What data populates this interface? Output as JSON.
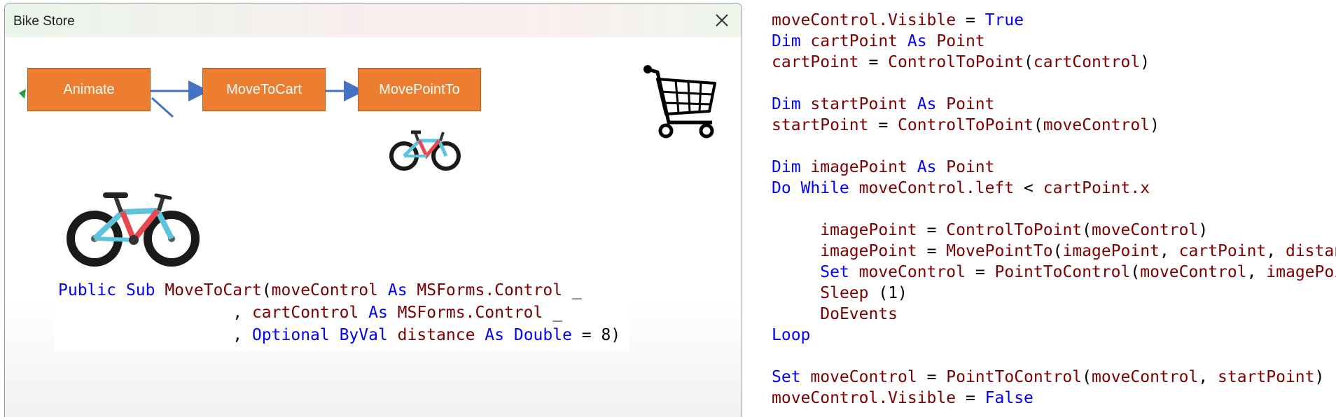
{
  "window": {
    "title": "Bike Store"
  },
  "flow": {
    "boxes": [
      "Animate",
      "MoveToCart",
      "MovePointTo"
    ]
  },
  "colors": {
    "box": "#ed7d31",
    "keyword": "#0000ff",
    "identifier": "#7b0000",
    "arrow": "#4472c4"
  },
  "icons": [
    "close-icon",
    "cart-icon",
    "bike-small-image",
    "bike-large-image"
  ],
  "signature": [
    [
      [
        "kw",
        "Public "
      ],
      [
        "kw",
        "Sub "
      ],
      [
        "ide",
        "MoveToCart"
      ],
      [
        "pl",
        "("
      ],
      [
        "ide",
        "moveControl "
      ],
      [
        "kw",
        "As "
      ],
      [
        "ide",
        "MSForms.Control "
      ],
      [
        "pl",
        "_"
      ]
    ],
    [
      [
        "pl",
        "                  , "
      ],
      [
        "ide",
        "cartControl "
      ],
      [
        "kw",
        "As "
      ],
      [
        "ide",
        "MSForms.Control "
      ],
      [
        "pl",
        "_"
      ]
    ],
    [
      [
        "pl",
        "                  , "
      ],
      [
        "kw",
        "Optional "
      ],
      [
        "kw",
        "ByVal "
      ],
      [
        "ide",
        "distance "
      ],
      [
        "kw",
        "As "
      ],
      [
        "kw",
        "Double"
      ],
      [
        "pl",
        " = 8)"
      ]
    ]
  ],
  "code": [
    [
      [
        "ide",
        "moveControl.Visible"
      ],
      [
        "pl",
        " = "
      ],
      [
        "kw",
        "True"
      ]
    ],
    [
      [
        "kw",
        "Dim "
      ],
      [
        "ide",
        "cartPoint "
      ],
      [
        "kw",
        "As "
      ],
      [
        "ide",
        "Point"
      ]
    ],
    [
      [
        "ide",
        "cartPoint"
      ],
      [
        "pl",
        " = "
      ],
      [
        "ide",
        "ControlToPoint"
      ],
      [
        "pl",
        "("
      ],
      [
        "ide",
        "cartControl"
      ],
      [
        "pl",
        ")"
      ]
    ],
    [],
    [
      [
        "kw",
        "Dim "
      ],
      [
        "ide",
        "startPoint "
      ],
      [
        "kw",
        "As "
      ],
      [
        "ide",
        "Point"
      ]
    ],
    [
      [
        "ide",
        "startPoint"
      ],
      [
        "pl",
        " = "
      ],
      [
        "ide",
        "ControlToPoint"
      ],
      [
        "pl",
        "("
      ],
      [
        "ide",
        "moveControl"
      ],
      [
        "pl",
        ")"
      ]
    ],
    [],
    [
      [
        "kw",
        "Dim "
      ],
      [
        "ide",
        "imagePoint "
      ],
      [
        "kw",
        "As "
      ],
      [
        "ide",
        "Point"
      ]
    ],
    [
      [
        "kw",
        "Do "
      ],
      [
        "kw",
        "While "
      ],
      [
        "ide",
        "moveControl.left"
      ],
      [
        "pl",
        " < "
      ],
      [
        "ide",
        "cartPoint.x"
      ]
    ],
    [],
    [
      [
        "pl",
        "     "
      ],
      [
        "ide",
        "imagePoint"
      ],
      [
        "pl",
        " = "
      ],
      [
        "ide",
        "ControlToPoint"
      ],
      [
        "pl",
        "("
      ],
      [
        "ide",
        "moveControl"
      ],
      [
        "pl",
        ")"
      ]
    ],
    [
      [
        "pl",
        "     "
      ],
      [
        "ide",
        "imagePoint"
      ],
      [
        "pl",
        " = "
      ],
      [
        "ide",
        "MovePointTo"
      ],
      [
        "pl",
        "("
      ],
      [
        "ide",
        "imagePoint"
      ],
      [
        "pl",
        ", "
      ],
      [
        "ide",
        "cartPoint"
      ],
      [
        "pl",
        ", "
      ],
      [
        "ide",
        "distance"
      ],
      [
        "pl",
        ")"
      ]
    ],
    [
      [
        "pl",
        "     "
      ],
      [
        "kw",
        "Set "
      ],
      [
        "ide",
        "moveControl"
      ],
      [
        "pl",
        " = "
      ],
      [
        "ide",
        "PointToControl"
      ],
      [
        "pl",
        "("
      ],
      [
        "ide",
        "moveControl"
      ],
      [
        "pl",
        ", "
      ],
      [
        "ide",
        "imagePoint"
      ],
      [
        "pl",
        ")"
      ]
    ],
    [
      [
        "pl",
        "     "
      ],
      [
        "ide",
        "Sleep"
      ],
      [
        "pl",
        " (1)"
      ]
    ],
    [
      [
        "pl",
        "     "
      ],
      [
        "ide",
        "DoEvents"
      ]
    ],
    [
      [
        "kw",
        "Loop"
      ]
    ],
    [],
    [
      [
        "kw",
        "Set "
      ],
      [
        "ide",
        "moveControl"
      ],
      [
        "pl",
        " = "
      ],
      [
        "ide",
        "PointToControl"
      ],
      [
        "pl",
        "("
      ],
      [
        "ide",
        "moveControl"
      ],
      [
        "pl",
        ", "
      ],
      [
        "ide",
        "startPoint"
      ],
      [
        "pl",
        ")"
      ]
    ],
    [
      [
        "ide",
        "moveControl.Visible"
      ],
      [
        "pl",
        " = "
      ],
      [
        "kw",
        "False"
      ]
    ]
  ]
}
